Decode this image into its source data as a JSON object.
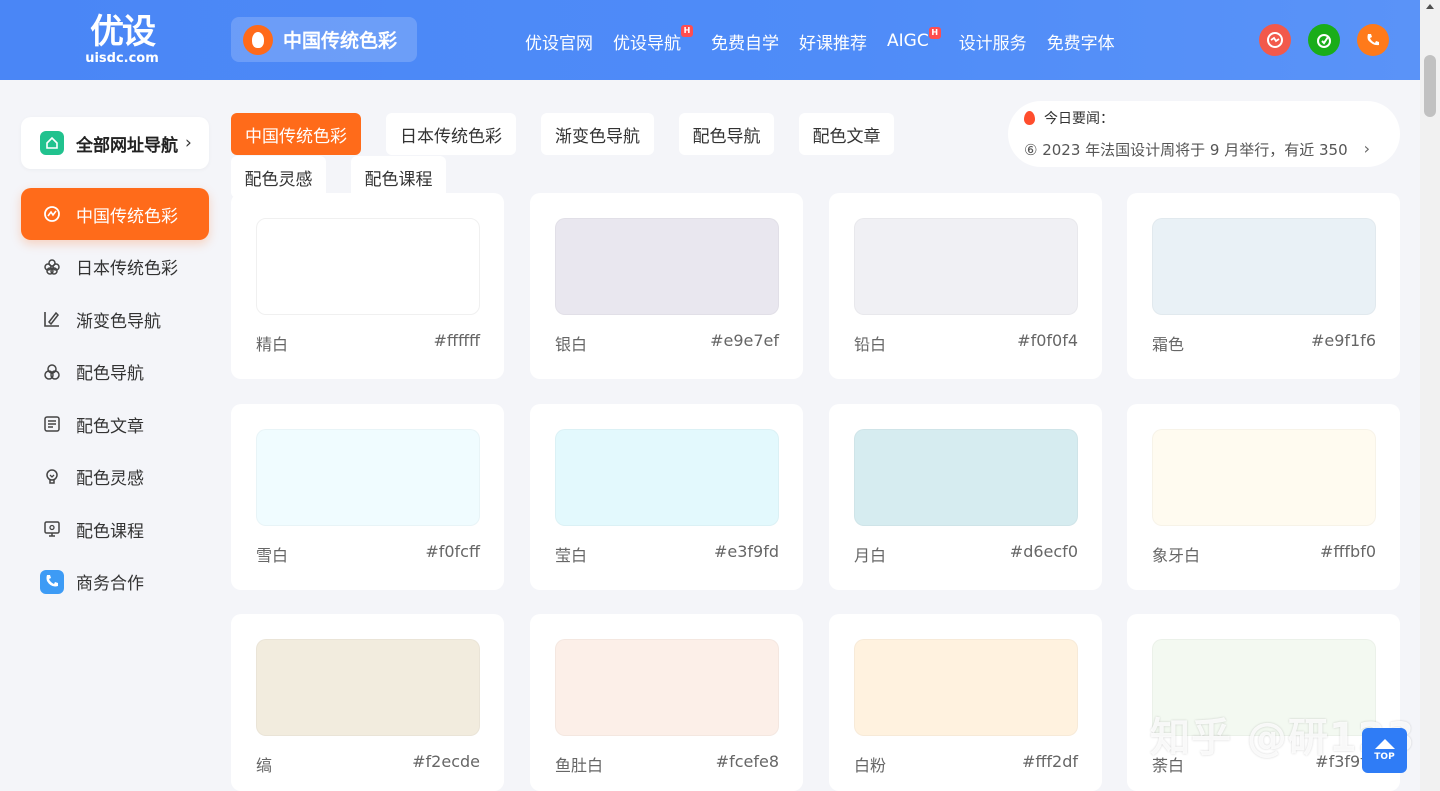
{
  "header": {
    "logo_main": "优设",
    "logo_sub": "uisdc.com",
    "site_title": "中国传统色彩",
    "nav": [
      {
        "label": "优设官网",
        "hot": ""
      },
      {
        "label": "优设导航",
        "hot": "H"
      },
      {
        "label": "免费自学",
        "hot": ""
      },
      {
        "label": "好课推荐",
        "hot": ""
      },
      {
        "label": "AIGC",
        "hot": "H"
      },
      {
        "label": "设计服务",
        "hot": ""
      },
      {
        "label": "免费字体",
        "hot": ""
      }
    ],
    "circle_buttons": [
      {
        "icon": "feedback-icon",
        "color": "#f2594b"
      },
      {
        "icon": "wechat-icon",
        "color": "#1aad19"
      },
      {
        "icon": "phone-icon",
        "color": "#ff7a1a"
      }
    ]
  },
  "sidebar": {
    "all_nav_label": "全部网址导航",
    "items": [
      {
        "label": "中国传统色彩",
        "icon": "color-palette-icon",
        "active": true
      },
      {
        "label": "日本传统色彩",
        "icon": "flower-icon",
        "active": false
      },
      {
        "label": "渐变色导航",
        "icon": "gradient-icon",
        "active": false
      },
      {
        "label": "配色导航",
        "icon": "color-circles-icon",
        "active": false
      },
      {
        "label": "配色文章",
        "icon": "article-icon",
        "active": false
      },
      {
        "label": "配色灵感",
        "icon": "lightbulb-icon",
        "active": false
      },
      {
        "label": "配色课程",
        "icon": "course-icon",
        "active": false
      },
      {
        "label": "商务合作",
        "icon": "phone-icon",
        "active": false
      }
    ]
  },
  "tabs": [
    {
      "label": "中国传统色彩",
      "active": true
    },
    {
      "label": "日本传统色彩",
      "active": false
    },
    {
      "label": "渐变色导航",
      "active": false
    },
    {
      "label": "配色导航",
      "active": false
    },
    {
      "label": "配色文章",
      "active": false
    },
    {
      "label": "配色灵感",
      "active": false
    },
    {
      "label": "配色课程",
      "active": false
    }
  ],
  "news": {
    "title": "今日要闻：",
    "text": "⑥ 2023 年法国设计周将于 9 月举行，有近 350"
  },
  "colors": [
    {
      "name": "精白",
      "hex": "#ffffff"
    },
    {
      "name": "银白",
      "hex": "#e9e7ef"
    },
    {
      "name": "铅白",
      "hex": "#f0f0f4"
    },
    {
      "name": "霜色",
      "hex": "#e9f1f6"
    },
    {
      "name": "雪白",
      "hex": "#f0fcff"
    },
    {
      "name": "莹白",
      "hex": "#e3f9fd"
    },
    {
      "name": "月白",
      "hex": "#d6ecf0"
    },
    {
      "name": "象牙白",
      "hex": "#fffbf0"
    },
    {
      "name": "缟",
      "hex": "#f2ecde"
    },
    {
      "name": "鱼肚白",
      "hex": "#fcefe8"
    },
    {
      "name": "白粉",
      "hex": "#fff2df"
    },
    {
      "name": "荼白",
      "hex": "#f3f9f1"
    }
  ],
  "watermark": "知乎 @研123",
  "top_button_label": "TOP"
}
